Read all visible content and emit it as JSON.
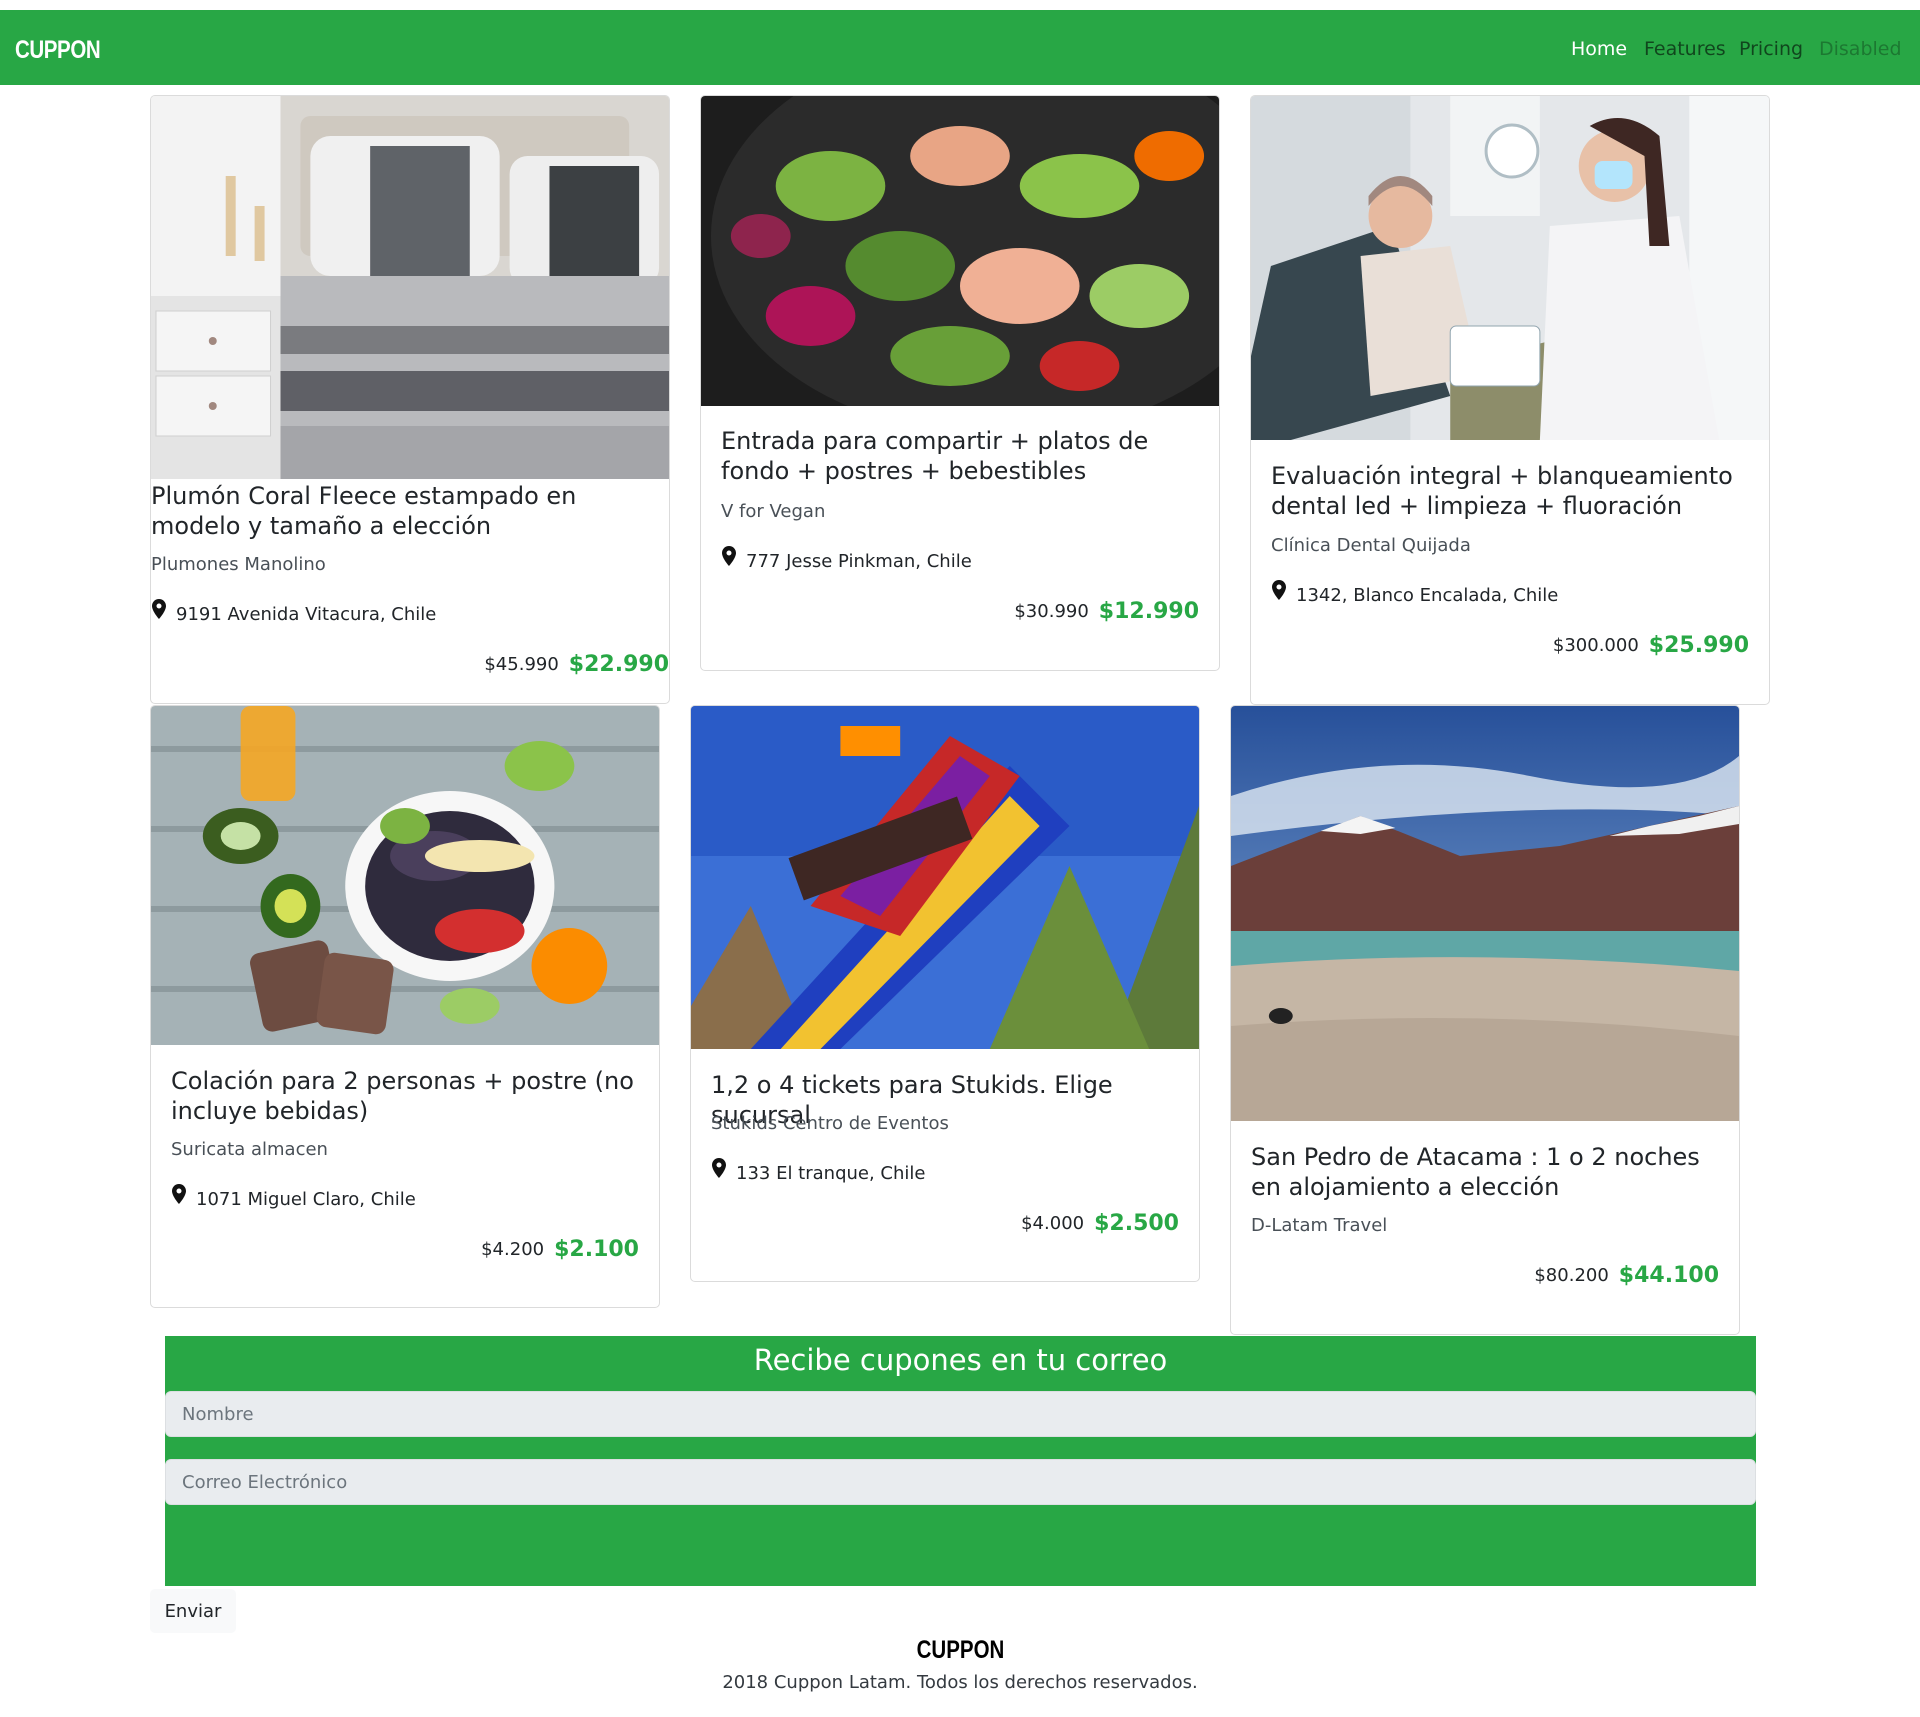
{
  "navbar": {
    "brand": "CUPPON",
    "links": [
      {
        "label": "Home"
      },
      {
        "label": "Features"
      },
      {
        "label": "Pricing"
      },
      {
        "label": "Disabled"
      }
    ]
  },
  "deals": [
    {
      "title": "Plumón Coral Fleece estampado en modelo y tamaño a elección",
      "vendor": "Plumones Manolino",
      "location": "9191 Avenida Vitacura, Chile",
      "old_price": "$45.990",
      "new_price": "$22.990"
    },
    {
      "title": "Entrada para compartir + platos de fondo + postres + bebestibles",
      "vendor": "V for Vegan",
      "location": "777 Jesse Pinkman, Chile",
      "old_price": "$30.990",
      "new_price": "$12.990"
    },
    {
      "title": "Evaluación integral + blanqueamiento dental led + limpieza + fluoración",
      "vendor": "Clínica Dental Quijada",
      "location": "1342, Blanco Encalada, Chile",
      "old_price": "$300.000",
      "new_price": "$25.990"
    },
    {
      "title": "Colación para 2 personas + postre (no incluye bebidas)",
      "vendor": "Suricata almacen",
      "location": "1071 Miguel Claro, Chile",
      "old_price": "$4.200",
      "new_price": "$2.100"
    },
    {
      "title": "1,2 o 4 tickets para Stukids. Elige sucursal",
      "vendor": "Stukids Centro de Eventos",
      "location": "133 El tranque, Chile",
      "old_price": "$4.000",
      "new_price": "$2.500"
    },
    {
      "title": "San Pedro de Atacama : 1 o 2 noches en alojamiento a elección",
      "vendor": "D-Latam Travel",
      "old_price": "$80.200",
      "new_price": "$44.100"
    }
  ],
  "newsletter": {
    "title": "Recibe cupones en tu correo",
    "name_placeholder": "Nombre",
    "email_placeholder": "Correo Electrónico",
    "submit_label": "Enviar"
  },
  "footer": {
    "brand": "CUPPON",
    "copyright": "2018 Cuppon Latam. Todos los derechos reservados."
  },
  "colors": {
    "brand_green": "#28a745",
    "input_gray": "#e9ecef"
  },
  "icons": {
    "location": "map-pin-icon"
  }
}
